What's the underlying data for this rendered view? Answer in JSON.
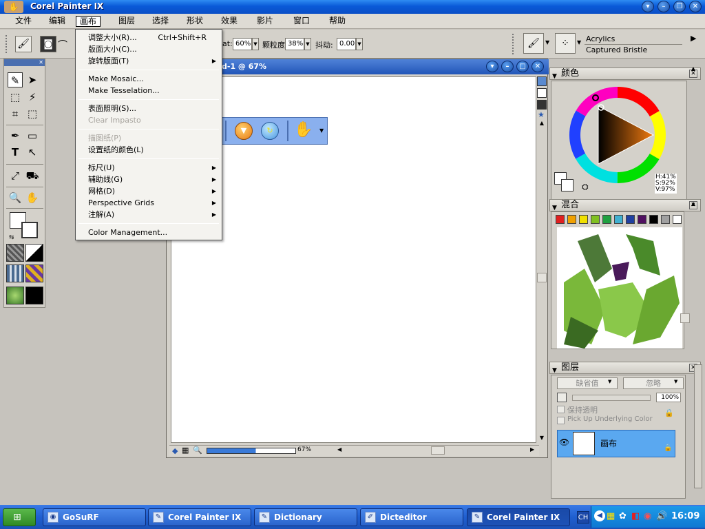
{
  "app_title": "Corel Painter IX",
  "menubar": [
    "文件",
    "编辑",
    "画布",
    "图层",
    "选择",
    "形状",
    "效果",
    "影片",
    "窗口",
    "帮助"
  ],
  "active_menu": "画布",
  "toolbar": {
    "opacity_label": "at:",
    "opacity_value": "60%",
    "grain_label": "颗粒度:",
    "grain_value": "38%",
    "jitter_label": "抖动:",
    "jitter_value": "0.00",
    "brush_category": "Acrylics",
    "brush_variant": "Captured Bristle"
  },
  "dropdown": [
    {
      "label": "调整大小(R)...",
      "shortcut": "Ctrl+Shift+R"
    },
    {
      "label": "版面大小(C)..."
    },
    {
      "label": "旋转版面(T)",
      "submenu": true
    },
    {
      "sep": true
    },
    {
      "label": "Make Mosaic..."
    },
    {
      "label": "Make Tesselation..."
    },
    {
      "sep": true
    },
    {
      "label": "表面照明(S)..."
    },
    {
      "label": "Clear Impasto",
      "disabled": true
    },
    {
      "sep": true
    },
    {
      "label": "描图纸(P)",
      "disabled": true
    },
    {
      "label": "设置纸的颜色(L)"
    },
    {
      "sep": true
    },
    {
      "label": "标尺(U)",
      "submenu": true
    },
    {
      "label": "辅助线(G)",
      "submenu": true
    },
    {
      "label": "网格(D)",
      "submenu": true
    },
    {
      "label": "Perspective Grids",
      "submenu": true
    },
    {
      "label": "注解(A)",
      "submenu": true
    },
    {
      "sep": true
    },
    {
      "label": "Color Management..."
    }
  ],
  "document": {
    "title": "d-1 @ 67%",
    "zoom": "67%"
  },
  "color_panel": {
    "title": "颜色",
    "h": "H:41%",
    "s": "S:92%",
    "v": "V:97%"
  },
  "mixer_panel": {
    "title": "混合",
    "chips": [
      "#e02020",
      "#f0a000",
      "#f0e000",
      "#80c020",
      "#20a040",
      "#40b0d0",
      "#2040a0",
      "#501060",
      "#000000",
      "#a0a0a0",
      "#ffffff"
    ]
  },
  "layers_panel": {
    "title": "图层",
    "composite_method": "缺省值",
    "composite_depth": "忽略",
    "opacity": "100%",
    "preserve_transparency": "保持透明",
    "pick_up_underlying": "Pick Up Underlying Color",
    "layer_name": "画布"
  },
  "taskbar": {
    "items": [
      "GoSuRF",
      "Corel Painter IX",
      "Dictionary",
      "Dicteditor",
      "Corel Painter IX"
    ],
    "active_index": 4,
    "lang": "CH",
    "clock": "16:09"
  },
  "colors": {
    "accent": "#2256b8",
    "selection": "#5aa8f0",
    "taskbar": "#1f5fd0"
  }
}
